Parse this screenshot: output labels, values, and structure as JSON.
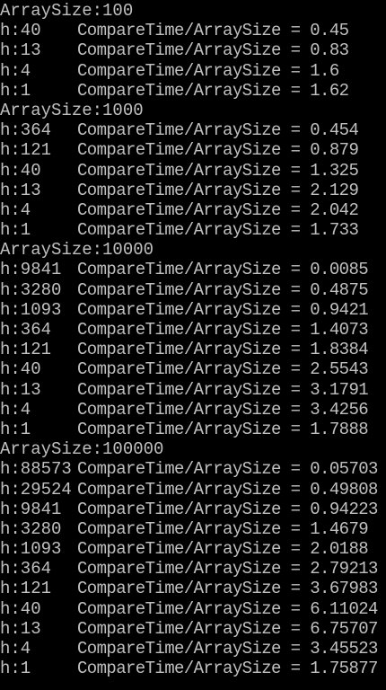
{
  "colors": {
    "background": "#000000",
    "text": "#c0c0c0"
  },
  "blocks": [
    {
      "header": "ArraySize:100",
      "rows": [
        {
          "h": "h:40",
          "text": "CompareTime/ArraySize = 0.45"
        },
        {
          "h": "h:13",
          "text": "CompareTime/ArraySize = 0.83"
        },
        {
          "h": "h:4",
          "text": "CompareTime/ArraySize = 1.6"
        },
        {
          "h": "h:1",
          "text": "CompareTime/ArraySize = 1.62"
        }
      ]
    },
    {
      "header": "ArraySize:1000",
      "rows": [
        {
          "h": "h:364",
          "text": "CompareTime/ArraySize = 0.454"
        },
        {
          "h": "h:121",
          "text": "CompareTime/ArraySize = 0.879"
        },
        {
          "h": "h:40",
          "text": "CompareTime/ArraySize = 1.325"
        },
        {
          "h": "h:13",
          "text": "CompareTime/ArraySize = 2.129"
        },
        {
          "h": "h:4",
          "text": "CompareTime/ArraySize = 2.042"
        },
        {
          "h": "h:1",
          "text": "CompareTime/ArraySize = 1.733"
        }
      ]
    },
    {
      "header": "ArraySize:10000",
      "rows": [
        {
          "h": "h:9841",
          "text": "CompareTime/ArraySize = 0.0085"
        },
        {
          "h": "h:3280",
          "text": "CompareTime/ArraySize = 0.4875"
        },
        {
          "h": "h:1093",
          "text": "CompareTime/ArraySize = 0.9421"
        },
        {
          "h": "h:364",
          "text": "CompareTime/ArraySize = 1.4073"
        },
        {
          "h": "h:121",
          "text": "CompareTime/ArraySize = 1.8384"
        },
        {
          "h": "h:40",
          "text": "CompareTime/ArraySize = 2.5543"
        },
        {
          "h": "h:13",
          "text": "CompareTime/ArraySize = 3.1791"
        },
        {
          "h": "h:4",
          "text": "CompareTime/ArraySize = 3.4256"
        },
        {
          "h": "h:1",
          "text": "CompareTime/ArraySize = 1.7888"
        }
      ]
    },
    {
      "header": "ArraySize:100000",
      "rows": [
        {
          "h": "h:88573",
          "text": "CompareTime/ArraySize = 0.05703"
        },
        {
          "h": "h:29524",
          "text": "CompareTime/ArraySize = 0.49808"
        },
        {
          "h": "h:9841",
          "text": "CompareTime/ArraySize = 0.94223"
        },
        {
          "h": "h:3280",
          "text": "CompareTime/ArraySize = 1.4679"
        },
        {
          "h": "h:1093",
          "text": "CompareTime/ArraySize = 2.0188"
        },
        {
          "h": "h:364",
          "text": "CompareTime/ArraySize = 2.79213"
        },
        {
          "h": "h:121",
          "text": "CompareTime/ArraySize = 3.67983"
        },
        {
          "h": "h:40",
          "text": "CompareTime/ArraySize = 6.11024"
        },
        {
          "h": "h:13",
          "text": "CompareTime/ArraySize = 6.75707"
        },
        {
          "h": "h:4",
          "text": "CompareTime/ArraySize = 3.45523"
        },
        {
          "h": "h:1",
          "text": "CompareTime/ArraySize = 1.75877"
        }
      ]
    }
  ]
}
